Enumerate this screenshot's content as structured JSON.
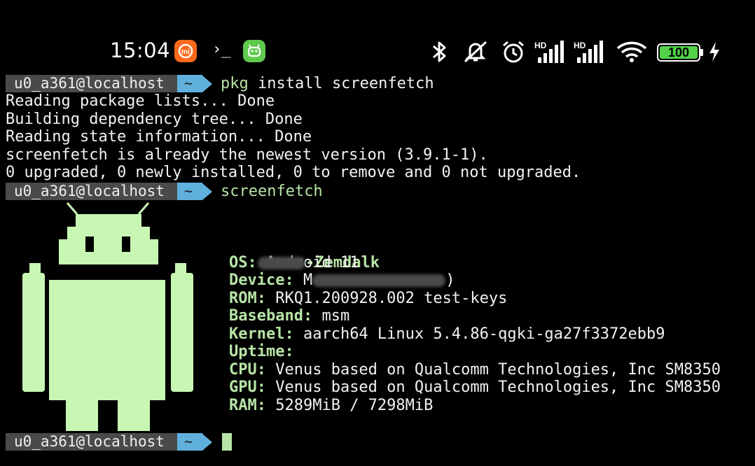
{
  "status_bar": {
    "time": "15:04",
    "apps": [
      "mi-app-icon",
      "terminal-icon",
      "android-app-icon"
    ],
    "terminal_glyph": "›_",
    "battery": "100",
    "icons": [
      "bluetooth-icon",
      "mute-icon",
      "alarm-icon",
      "signal-hd-icon",
      "signal-hd-icon",
      "wifi-icon",
      "battery-icon",
      "charging-icon"
    ],
    "signal_label_1": "HD",
    "signal_label_2": "HD"
  },
  "colors": {
    "prompt_user_bg": "#4a4a4a",
    "prompt_dir_bg": "#5fb0dc",
    "accent_green": "#b7e4a6"
  },
  "prompts": [
    {
      "user": "u0_a361@localhost",
      "dir": "~",
      "command": "pkg",
      "args": " install screenfetch"
    },
    {
      "user": "u0_a361@localhost",
      "dir": "~",
      "command": "screenfetch",
      "args": ""
    },
    {
      "user": "u0_a361@localhost",
      "dir": "~",
      "command": "",
      "args": ""
    }
  ],
  "output": [
    "Reading package lists... Done",
    "Building dependency tree... Done",
    "Reading state information... Done",
    "screenfetch is already the newest version (3.9.1-1).",
    "0 upgraded, 0 newly installed, 0 to remove and 0 not upgraded."
  ],
  "screenfetch": {
    "host": "-Zemdalk",
    "os_k": "OS:",
    "os_v": " Android 11",
    "device_k": "Device:",
    "device_v": " M",
    "device_tail": ")",
    "rom_k": "ROM:",
    "rom_v": " RKQ1.200928.002 test-keys",
    "baseband_k": "Baseband:",
    "baseband_v": " msm",
    "kernel_k": "Kernel:",
    "kernel_v": " aarch64 Linux 5.4.86-qgki-ga27f3372ebb9",
    "uptime_k": "Uptime:",
    "uptime_v": "",
    "cpu_k": "CPU:",
    "cpu_v": " Venus based on Qualcomm Technologies, Inc SM8350",
    "gpu_k": "GPU:",
    "gpu_v": " Venus based on Qualcomm Technologies, Inc SM8350",
    "ram_k": "RAM:",
    "ram_v": " 5289MiB / 7298MiB"
  }
}
